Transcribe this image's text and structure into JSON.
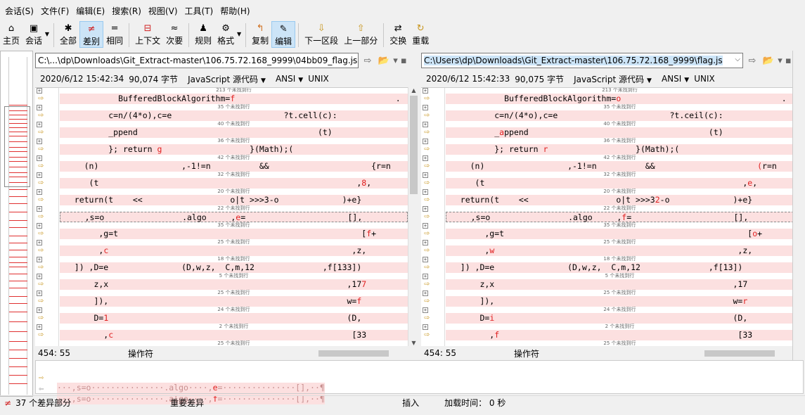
{
  "menu": [
    "会话(S)",
    "文件(F)",
    "编辑(E)",
    "搜索(R)",
    "视图(V)",
    "工具(T)",
    "帮助(H)"
  ],
  "toolbar": {
    "home": "主页",
    "session": "会话",
    "all": "全部",
    "diff": "差别",
    "same": "相同",
    "context": "上下文",
    "minor": "次要",
    "rules": "规则",
    "format": "格式",
    "copy": "复制",
    "edit": "编辑",
    "next": "下一区段",
    "prev": "上一部分",
    "swap": "交换",
    "reload": "重载"
  },
  "left": {
    "path": "C:\\...\\dp\\Downloads\\Git_Extract-master\\106.75.72.168_9999\\04bb09_flag.js",
    "date": "2020/6/12 15:42:34",
    "size": "90,074 字节",
    "type": "JavaScript 源代码",
    "enc": "ANSI",
    "eol": "UNIX",
    "pos": "454: 55",
    "mode": "操作符"
  },
  "right": {
    "path": "C:\\Users\\dp\\Downloads\\Git_Extract-master\\106.75.72.168_9999\\flag.js",
    "date": "2020/6/12 15:42:33",
    "size": "90,075 字节",
    "type": "JavaScript 源代码",
    "enc": "ANSI",
    "eol": "UNIX",
    "pos": "454: 55",
    "mode": "操作符"
  },
  "captions": [
    "213 个未找到行",
    "35 个未找到行",
    "40 个未找到行",
    "36 个未找到行",
    "42 个未找到行",
    "32 个未找到行",
    "20 个未找到行",
    "22 个未找到行",
    "35 个未找到行",
    "25 个未找到行",
    "18 个未找到行",
    "5 个未找到行",
    "25 个未找到行",
    "24 个未找到行",
    "2 个未找到行",
    "25 个未找到行"
  ],
  "left_lines": [
    [
      [
        "            BufferedBlockAlgorithm=",
        ""
      ],
      [
        "f",
        "r"
      ],
      [
        "                                 .",
        ""
      ]
    ],
    [
      [
        "          c=n/(4*o),c=e                       ?t.cell(c):",
        ""
      ]
    ],
    [
      [
        "          _ppend                                     (t)",
        ""
      ]
    ],
    [
      [
        "          }; return ",
        ""
      ],
      [
        "g",
        "r"
      ],
      [
        "                  }(Math);(",
        ""
      ]
    ],
    [
      [
        "     (n)                 ,-1!=n          &&                     {r=n",
        ""
      ]
    ],
    [
      [
        "      (t                                                     ,",
        ""
      ],
      [
        "8",
        "r"
      ],
      [
        ",",
        ""
      ]
    ],
    [
      [
        "   return(t    <<                  o|t >>>3-o             )+e}",
        ""
      ]
    ],
    [
      [
        "     ,s=o                .algo     ,",
        ""
      ],
      [
        "e",
        "r"
      ],
      [
        "=                     [],",
        ""
      ]
    ],
    [
      [
        "        ,g=t                                                  [",
        ""
      ],
      [
        "f",
        "r"
      ],
      [
        "+",
        ""
      ]
    ],
    [
      [
        "        ,",
        ""
      ],
      [
        "c",
        "r"
      ],
      [
        "                                                  ,z,",
        ""
      ]
    ],
    [
      [
        "   ]) ,D=e               (D,w,z,  C,m,12              ,f[133])",
        ""
      ]
    ],
    [
      [
        "       z,x                                                 ,17",
        ""
      ],
      [
        "7",
        "r"
      ]
    ],
    [
      [
        "       ]),                                                 w=",
        ""
      ],
      [
        "f",
        "r"
      ]
    ],
    [
      [
        "       D=",
        ""
      ],
      [
        "1",
        "r"
      ],
      [
        "                                                 (D,",
        ""
      ]
    ],
    [
      [
        "         ,",
        ""
      ],
      [
        "c",
        "r"
      ],
      [
        "                                                 [33",
        ""
      ]
    ]
  ],
  "right_lines": [
    [
      [
        "            BufferedBlockAlgorithm=",
        ""
      ],
      [
        "o",
        "r"
      ],
      [
        "                                 .",
        ""
      ]
    ],
    [
      [
        "          c=n/(4*o),c=e                       ?t.ceil(c):",
        ""
      ]
    ],
    [
      [
        "          _",
        ""
      ],
      [
        "a",
        "r"
      ],
      [
        "ppend                                     (t)",
        ""
      ]
    ],
    [
      [
        "          }; return ",
        ""
      ],
      [
        "r",
        "r"
      ],
      [
        "                  }(Math);(",
        ""
      ]
    ],
    [
      [
        "     (n)                 ,-1!=n          &&                     ",
        ""
      ],
      [
        "(",
        "r"
      ],
      [
        "r=n",
        ""
      ]
    ],
    [
      [
        "      (t                                                     ,",
        ""
      ],
      [
        "e",
        "r"
      ],
      [
        ",",
        ""
      ]
    ],
    [
      [
        "   return(t    <<                  o|t >>>3",
        ""
      ],
      [
        "2",
        "r"
      ],
      [
        "-o             )+e}",
        ""
      ]
    ],
    [
      [
        "     ,s=o                .algo     ,",
        ""
      ],
      [
        "f",
        "r"
      ],
      [
        "=                     [],",
        ""
      ]
    ],
    [
      [
        "        ,g=t                                                  [",
        ""
      ],
      [
        "o",
        "r"
      ],
      [
        "+",
        ""
      ]
    ],
    [
      [
        "        ,",
        ""
      ],
      [
        "w",
        "r"
      ],
      [
        "                                                  ,z,",
        ""
      ]
    ],
    [
      [
        "   ]) ,D=e               (D,w,z,  C,m,12              ,f[13])",
        ""
      ]
    ],
    [
      [
        "       z,x                                                 ,17",
        ""
      ]
    ],
    [
      [
        "       ]),                                                 w=",
        ""
      ],
      [
        "r",
        "r"
      ]
    ],
    [
      [
        "       D=",
        ""
      ],
      [
        "i",
        "r"
      ],
      [
        "                                                 (D,",
        ""
      ]
    ],
    [
      [
        "         ,",
        ""
      ],
      [
        "f",
        "r"
      ],
      [
        "                                                 [33",
        ""
      ]
    ]
  ],
  "bottom": {
    "line1_pre": "···,s=o···············.algo····,",
    "line1_ch": "e",
    "line1_post": "=···············[],··¶",
    "line2_pre": "···,s=o···············.algo····,",
    "line2_ch": "f",
    "line2_post": "=···············[],··¶"
  },
  "status": {
    "diffs": "37 个差异部分",
    "important": "重要差异",
    "insert": "插入",
    "load": "加载时间： 0 秒"
  },
  "colors": {
    "diff_bg": "#fce0e0",
    "diff_text": "#e02020",
    "active_tool": "#cce4f7"
  }
}
